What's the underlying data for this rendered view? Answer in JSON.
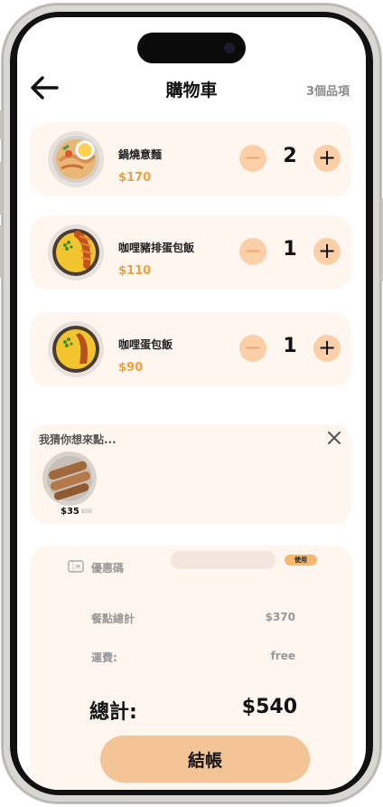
{
  "header": {
    "title": "購物車",
    "item_count": "3個品項"
  },
  "cart": {
    "items": [
      {
        "name": "鍋燒意麵",
        "price": "$170",
        "quantity": "2",
        "minus": "−",
        "plus": "+"
      },
      {
        "name": "咖哩豬排蛋包飯",
        "price": "$110",
        "quantity": "1",
        "minus": "−",
        "plus": "+"
      },
      {
        "name": "咖哩蛋包飯",
        "price": "$90",
        "quantity": "1",
        "minus": "−",
        "plus": "+"
      }
    ]
  },
  "suggestions": {
    "title": "我猜你想來點...",
    "items": [
      {
        "price": "$35",
        "original_price": "$50"
      }
    ]
  },
  "summary": {
    "coupon_label": "優惠碼",
    "coupon_placeholder": "",
    "coupon_button": "使用",
    "subtotal_label": "餐點總計",
    "subtotal_value": "$370",
    "shipping_label": "運費:",
    "shipping_value": "free",
    "total_label": "總計:",
    "total_value": "$540"
  },
  "checkout_label": "結帳",
  "colors": {
    "accent": "#f0a040",
    "card_bg": "#fff6f0",
    "qty_button": "#fbd0a9",
    "checkout_button": "#f3c496"
  }
}
